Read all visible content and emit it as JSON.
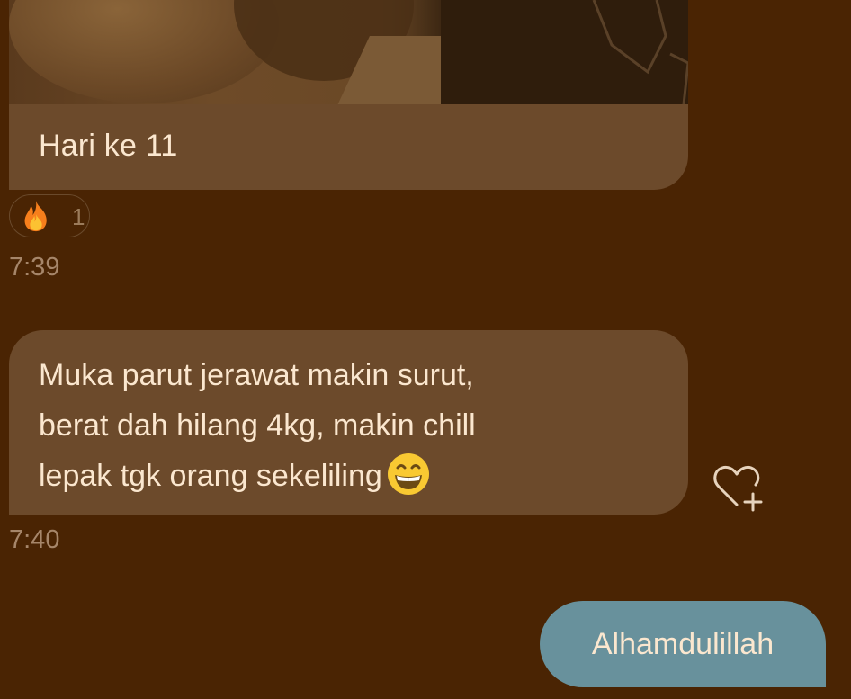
{
  "chat": {
    "messages": [
      {
        "type": "image",
        "caption": "Hari ke 11",
        "reaction": {
          "emoji": "fire",
          "count": "1"
        },
        "time": "7:39"
      },
      {
        "type": "text",
        "lines": [
          "Muka parut jerawat makin surut,",
          "berat dah hilang 4kg, makin chill",
          "lepak tgk orang sekeliling"
        ],
        "trailing_emoji": "grinning-face-with-smiling-eyes",
        "time": "7:40"
      },
      {
        "type": "sent",
        "text": "Alhamdulillah"
      }
    ],
    "actions": {
      "react_icon": "heart-plus-icon"
    }
  },
  "colors": {
    "background": "#4a2403",
    "received_bubble": "#6c4a2b",
    "sent_bubble": "#68919c",
    "message_text": "#fbe7cf",
    "timestamp_text": "#a6866a"
  }
}
